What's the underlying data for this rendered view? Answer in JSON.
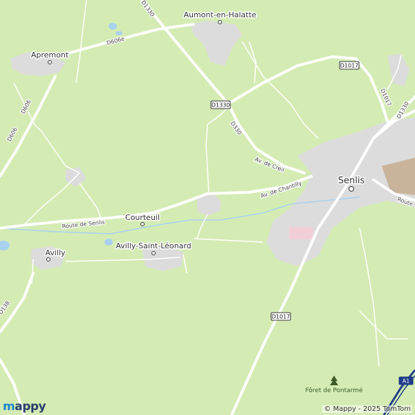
{
  "map": {
    "colors": {
      "land": "#d4ecb4",
      "road": "#ffffff",
      "urban": "#d9d9d9",
      "water": "#a9d1f0",
      "motorway": "#1f3c88",
      "hospital": "#f2cfd6",
      "industrial": "#c9b49b"
    },
    "towns": {
      "aumont": "Aumont-en-Halatte",
      "apremont": "Apremont",
      "senlis": "Senlis",
      "courteuil": "Courteuil",
      "avilly_saint_leonard": "Avilly-Saint-Léonard",
      "avilly": "Avilly"
    },
    "roads": {
      "d1330_top": "D1330",
      "d1330_shield": "D1330",
      "d330": "D330",
      "d606e": "D606e",
      "d606": "D606",
      "d606_b": "D606",
      "d138": "D138",
      "d1017_top": "D1017",
      "d1017_mid": "D1017",
      "d1017_right": "D1017",
      "d1330_right": "D1330",
      "a1": "A1",
      "route_de_senlis": "Route de Senlis",
      "av_de_creil": "Av. de Creil",
      "av_de_chantilly": "Av. de Chantilly",
      "route_right": "Route"
    },
    "pois": {
      "foret": "Fôret de Pontarmé",
      "tree_icon": "tree-icon"
    }
  },
  "branding": {
    "logo_prefix": "m",
    "logo_suffix": "appy",
    "copyright": "© Mappy - 2025 TomTom"
  }
}
